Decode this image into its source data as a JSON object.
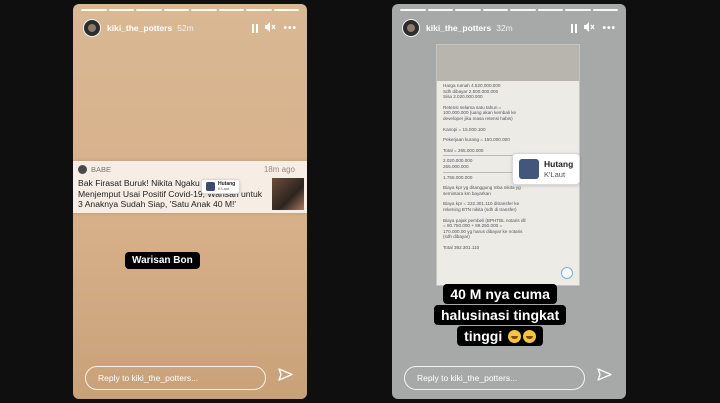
{
  "left_story": {
    "username": "kiki_the_potters",
    "time": "52m",
    "news": {
      "source": "BABE",
      "time": "18m ago",
      "headline": "Bak Firasat Buruk! Nikita Ngaku Takut Ajal Menjemput Usai Positif Covid-19, Warisan untuk 3 Anaknya Sudah Siap, 'Satu Anak 40 M!'"
    },
    "chip": {
      "title": "Hutang",
      "subtitle": "K'Laut"
    },
    "caption": "Warisan Bon",
    "reply_placeholder": "Reply to kiki_the_potters..."
  },
  "right_story": {
    "username": "kiki_the_potters",
    "time": "32m",
    "screenshot_lines": [
      "Harga rumah 4.520.000.000",
      "Sdh dibayar 2.500.000.000",
      "Sisa 2.020.000.000",
      "",
      "Retensi selama satu tahun =",
      "100.000.000 (uang akan kembali ke",
      "developer jika masa retensi habis)",
      "",
      "Kanopi = 15.000.100",
      "",
      "Pekerjaan kurang = 150.000.000",
      "",
      "Total = 265.000.000",
      "---",
      "2.020.000.000",
      "  265.000.000",
      "---",
      "1.755.000.000",
      "",
      "Biaya kpr yg ditanggung mba nikita yg",
      "semintara km bayarkan",
      "",
      "Biaya kpr = 222.301.110 ditransfer ke",
      "rekening BTN nikita (sdh di transfer)",
      "",
      "Biaya pajak pembeli (BPHTBL notaris dll",
      "= 80.750.000 + 89.250.000 =",
      "170.000.00 yg harus dibayar ke notaris",
      "(sdh dibayar)",
      "",
      "Total 392.301.110"
    ],
    "chip": {
      "title": "Hutang",
      "subtitle": "K'Laut"
    },
    "caption_lines": [
      "40 M nya cuma",
      "halusinasi tingkat",
      "tinggi"
    ],
    "reply_placeholder": "Reply to kiki_the_potters..."
  },
  "icons": [
    "pause-icon",
    "mute-icon",
    "more-icon",
    "send-icon",
    "laughing-emoji-icon"
  ],
  "colors": {
    "background": "#0f0f0f",
    "left_story_bg": "#d7b089",
    "right_story_bg": "#a7a9a8"
  }
}
